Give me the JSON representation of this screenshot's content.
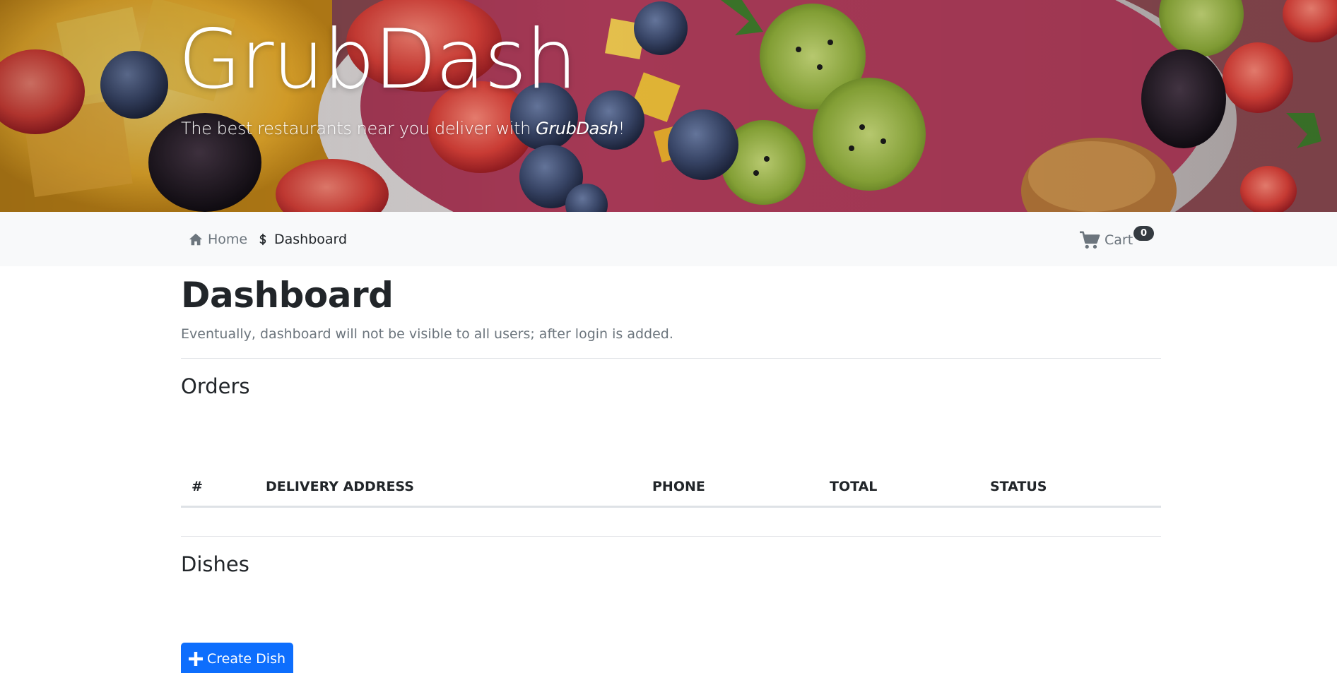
{
  "hero": {
    "title": "GrubDash",
    "subtitle_prefix": "The best restaurants near you deliver with ",
    "subtitle_brand": "GrubDash",
    "subtitle_suffix": "!"
  },
  "nav": {
    "home_label": "Home",
    "dashboard_label": "Dashboard",
    "cart_label": "Cart",
    "cart_count": "0"
  },
  "main": {
    "title": "Dashboard",
    "lead": "Eventually, dashboard will not be visible to all users; after login is added.",
    "orders": {
      "title": "Orders",
      "columns": [
        "#",
        "DELIVERY ADDRESS",
        "PHONE",
        "TOTAL",
        "STATUS"
      ],
      "rows": []
    },
    "dishes": {
      "title": "Dishes",
      "create_label": "Create Dish"
    }
  },
  "colors": {
    "primary": "#0d6efd",
    "nav_bg": "#f8f9fa",
    "muted_text": "#6c757d",
    "badge_bg": "#343a40"
  },
  "icons": {
    "home": "home-icon",
    "dashboard": "dollar-icon",
    "cart": "cart-icon",
    "create": "plus-icon"
  }
}
